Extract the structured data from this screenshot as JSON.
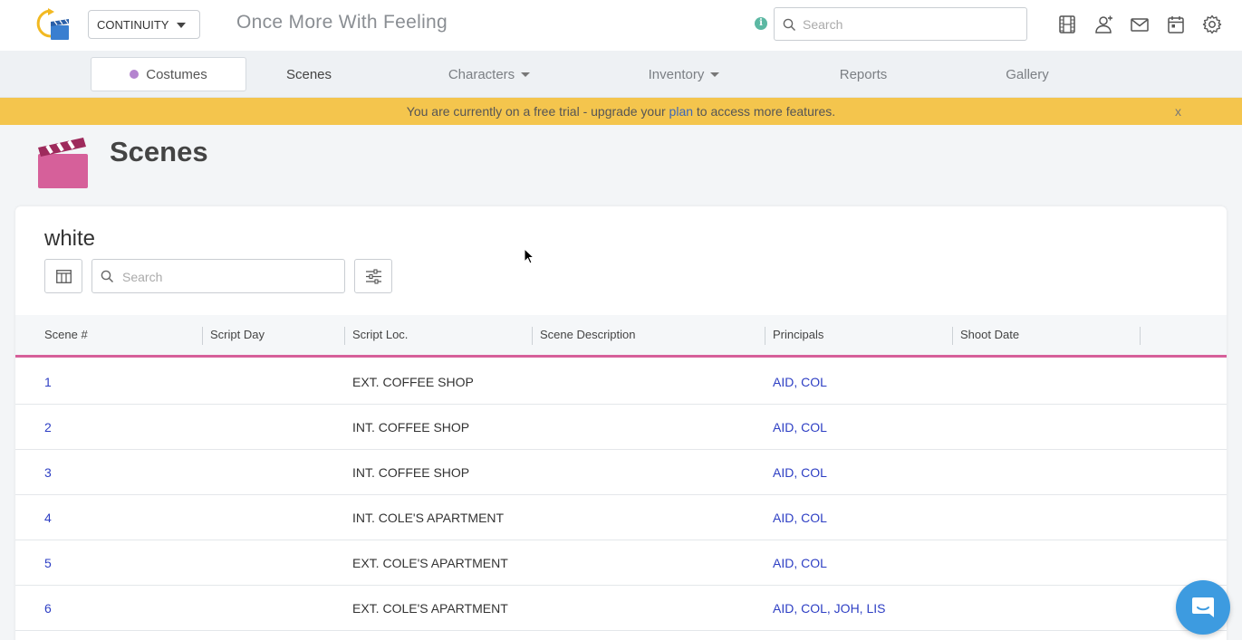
{
  "header": {
    "project_selector": "CONTINUITY",
    "app_title": "Once More With Feeling",
    "search_placeholder": "Search",
    "info_icon": "info-icon",
    "icons": [
      "film-icon",
      "add-user-icon",
      "mail-icon",
      "calendar-icon",
      "gear-icon"
    ]
  },
  "nav": {
    "items": [
      {
        "label": "Costumes"
      },
      {
        "label": "Scenes"
      },
      {
        "label": "Characters"
      },
      {
        "label": "Inventory"
      },
      {
        "label": "Reports"
      },
      {
        "label": "Gallery"
      }
    ]
  },
  "banner": {
    "text_before": "You are currently on a free trial - upgrade your ",
    "link": "plan",
    "text_after": " to access more features.",
    "close": "x"
  },
  "page": {
    "title": "Scenes",
    "icon": "clapperboard-icon"
  },
  "card": {
    "title": "white",
    "search_placeholder": "Search"
  },
  "table": {
    "columns": [
      "Scene #",
      "Script Day",
      "Script Loc.",
      "Scene Description",
      "Principals",
      "Shoot Date"
    ],
    "rows": [
      {
        "scene": "1",
        "script_day": "",
        "script_loc": "EXT. COFFEE SHOP",
        "description": "",
        "principals": "AID, COL",
        "shoot_date": ""
      },
      {
        "scene": "2",
        "script_day": "",
        "script_loc": "INT. COFFEE SHOP",
        "description": "",
        "principals": "AID, COL",
        "shoot_date": ""
      },
      {
        "scene": "3",
        "script_day": "",
        "script_loc": "INT. COFFEE SHOP",
        "description": "",
        "principals": "AID, COL",
        "shoot_date": ""
      },
      {
        "scene": "4",
        "script_day": "",
        "script_loc": "INT. COLE'S APARTMENT",
        "description": "",
        "principals": "AID, COL",
        "shoot_date": ""
      },
      {
        "scene": "5",
        "script_day": "",
        "script_loc": "EXT. COLE'S APARTMENT",
        "description": "",
        "principals": "AID, COL",
        "shoot_date": ""
      },
      {
        "scene": "6",
        "script_day": "",
        "script_loc": "EXT. COLE'S APARTMENT",
        "description": "",
        "principals": "AID, COL, JOH, LIS",
        "shoot_date": ""
      }
    ]
  },
  "colors": {
    "accent_pink": "#d6609a",
    "banner_yellow": "#f4c54d",
    "link_blue": "#2e3fc4",
    "chat_blue": "#3d9be0"
  }
}
